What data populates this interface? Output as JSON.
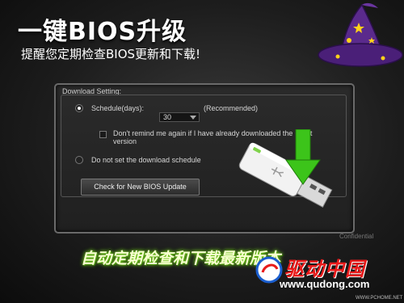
{
  "header": {
    "title": "一键BIOS升级",
    "subtitle": "提醒您定期检查BIOS更新和下载!"
  },
  "panel": {
    "legend": "Download Setting:",
    "option_schedule_label": "Schedule(days):",
    "schedule_value": "30",
    "recommended": "(Recommended)",
    "dont_remind_line1": "Don't remind me again if I have already downloaded the latest",
    "dont_remind_line2": "version",
    "option_no_schedule_label": "Do not set the download schedule",
    "check_button": "Check for New BIOS Update"
  },
  "slogan": "自动定期检查和下载最新版本",
  "logo": {
    "name": "驱动中国",
    "url": "www.qudong.com"
  },
  "watermarks": {
    "confidential": "Confidential",
    "site": "WWW.PCHOME.NET"
  },
  "colors": {
    "slogan_glow": "#7ed321",
    "logo_red": "#e81a1a",
    "arrow_green": "#3cc41a"
  },
  "icons": [
    "wizard-hat-icon",
    "usb-drive-icon",
    "download-arrow-icon",
    "radio-icon",
    "checkbox-icon",
    "dropdown-arrow-icon"
  ]
}
